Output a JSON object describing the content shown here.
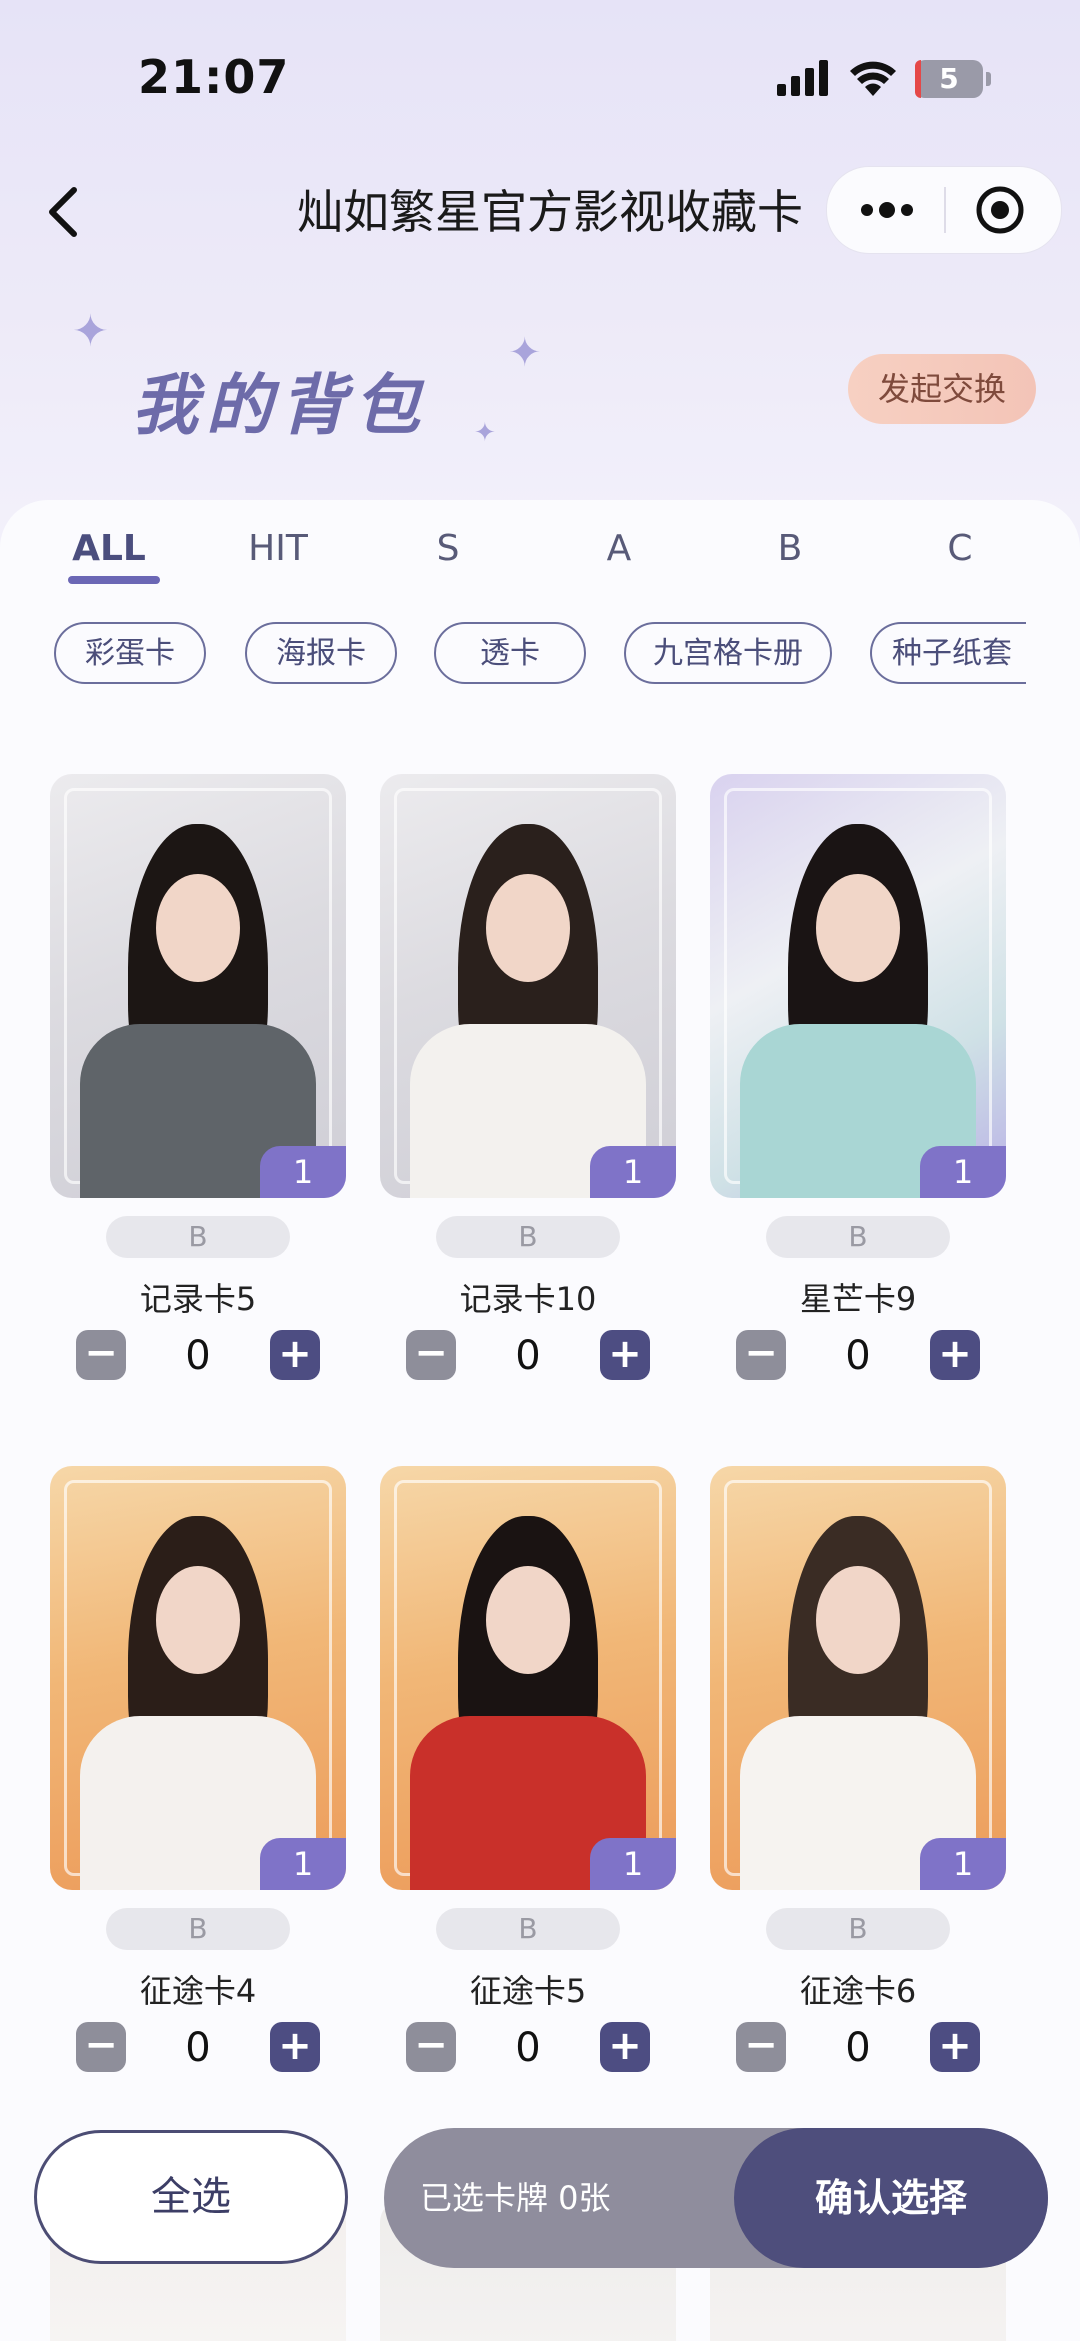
{
  "status_bar": {
    "time": "21:07",
    "battery": "5"
  },
  "nav": {
    "title": "灿如繁星官方影视收藏卡"
  },
  "header": {
    "heading": "我的背包",
    "exchange_label": "发起交换"
  },
  "tabs": [
    {
      "label": "ALL",
      "active": true
    },
    {
      "label": "HIT"
    },
    {
      "label": "S"
    },
    {
      "label": "A"
    },
    {
      "label": "B"
    },
    {
      "label": "C"
    }
  ],
  "chips": [
    "彩蛋卡",
    "海报卡",
    "透卡",
    "九宫格卡册",
    "种子纸套"
  ],
  "cards": [
    {
      "name": "记录卡5",
      "rarity": "B",
      "owned": "1",
      "selected": "0",
      "theme": "record",
      "hair": "#1c1614",
      "top": "#5f6469"
    },
    {
      "name": "记录卡10",
      "rarity": "B",
      "owned": "1",
      "selected": "0",
      "theme": "record",
      "hair": "#2a201c",
      "top": "#f3f1ee"
    },
    {
      "name": "星芒卡9",
      "rarity": "B",
      "owned": "1",
      "selected": "0",
      "theme": "star",
      "hair": "#1a1414",
      "top": "#a9d6d4"
    },
    {
      "name": "征途卡4",
      "rarity": "B",
      "owned": "1",
      "selected": "0",
      "theme": "journey",
      "hair": "#2b1e18",
      "top": "#f4f1ee"
    },
    {
      "name": "征途卡5",
      "rarity": "B",
      "owned": "1",
      "selected": "0",
      "theme": "journey",
      "hair": "#1a1312",
      "top": "#c9302a"
    },
    {
      "name": "征途卡6",
      "rarity": "B",
      "owned": "1",
      "selected": "0",
      "theme": "journey",
      "hair": "#3a2c24",
      "top": "#f6f3f0"
    }
  ],
  "bottom_bar": {
    "select_all_label": "全选",
    "selected_summary": "已选卡牌 0张",
    "confirm_label": "确认选择"
  },
  "colors": {
    "accent": "#4e4e7c",
    "badge": "#7f73c8",
    "heading": "#6d6ba9"
  },
  "icons": [
    "back-arrow-icon",
    "more-dots-icon",
    "target-icon",
    "signal-icon",
    "wifi-icon",
    "minus-icon",
    "plus-icon"
  ]
}
